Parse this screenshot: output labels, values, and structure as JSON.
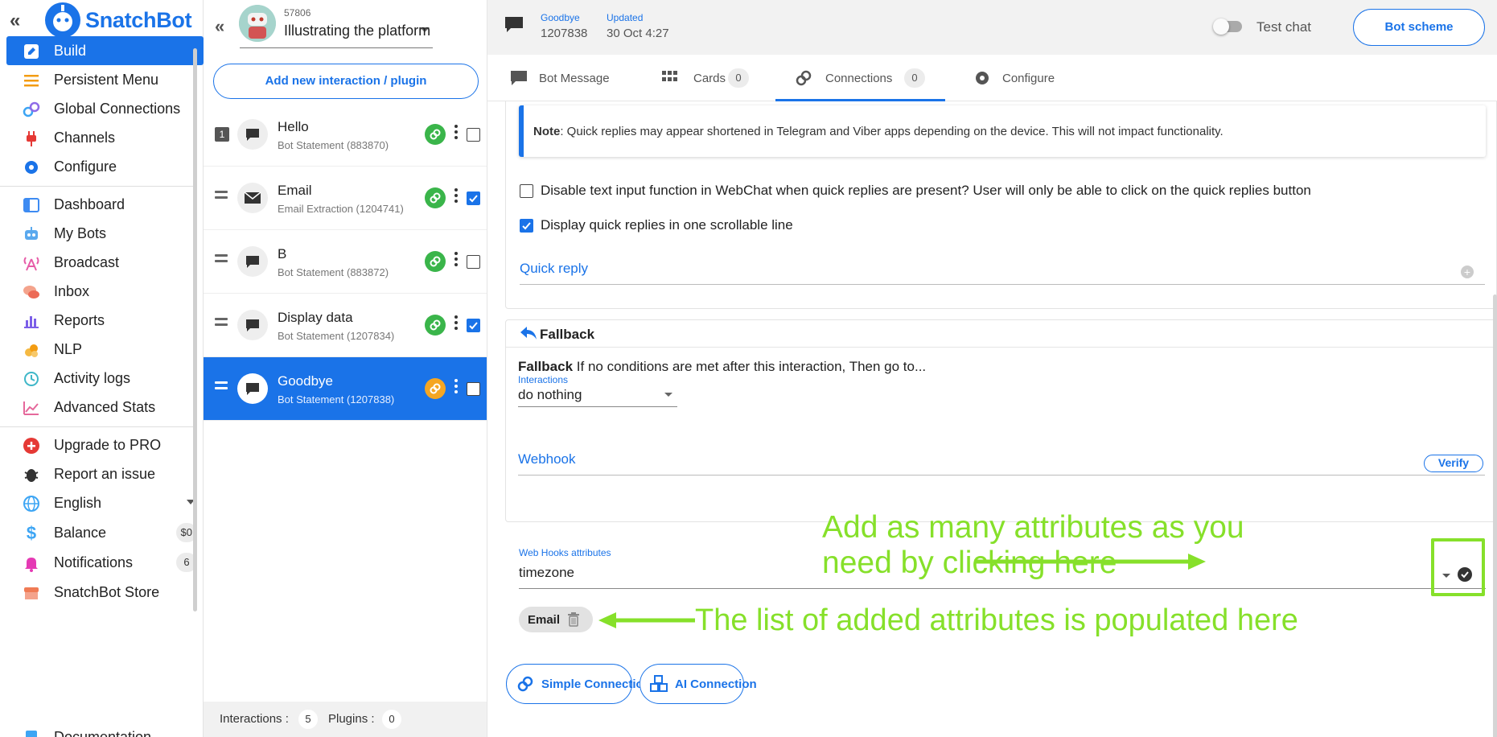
{
  "brand": {
    "name": "SnatchBot"
  },
  "sidebar": {
    "items": [
      {
        "label": "Build"
      },
      {
        "label": "Persistent Menu"
      },
      {
        "label": "Global Connections"
      },
      {
        "label": "Channels"
      },
      {
        "label": "Configure"
      },
      {
        "label": "Dashboard"
      },
      {
        "label": "My Bots"
      },
      {
        "label": "Broadcast"
      },
      {
        "label": "Inbox"
      },
      {
        "label": "Reports"
      },
      {
        "label": "NLP"
      },
      {
        "label": "Activity logs"
      },
      {
        "label": "Advanced Stats"
      },
      {
        "label": "Upgrade to PRO"
      },
      {
        "label": "Report an issue"
      },
      {
        "label": "English"
      },
      {
        "label": "Balance",
        "badge": "$0"
      },
      {
        "label": "Notifications",
        "badge": "6"
      },
      {
        "label": "SnatchBot Store"
      },
      {
        "label": "Documentation"
      }
    ]
  },
  "bot": {
    "id": "57806",
    "name": "Illustrating the platform"
  },
  "interactions": {
    "add_label": "Add new interaction / plugin",
    "rows": [
      {
        "index": "1",
        "title": "Hello",
        "subtitle": "Bot Statement (883870)",
        "checked": false
      },
      {
        "title": "Email",
        "subtitle": "Email Extraction (1204741)",
        "checked": true
      },
      {
        "title": "B",
        "subtitle": "Bot Statement (883872)",
        "checked": false
      },
      {
        "title": "Display data",
        "subtitle": "Bot Statement (1207834)",
        "checked": true
      },
      {
        "title": "Goodbye",
        "subtitle": "Bot Statement (1207838)",
        "checked": false
      }
    ],
    "footer": {
      "interactions_label": "Interactions :",
      "interactions_count": "5",
      "plugins_label": "Plugins :",
      "plugins_count": "0"
    }
  },
  "header": {
    "name": "Goodbye",
    "id": "1207838",
    "updated_label": "Updated",
    "updated_value": "30 Oct 4:27",
    "test_chat": "Test chat",
    "scheme_button": "Bot scheme"
  },
  "tabs": [
    {
      "label": "Bot Message"
    },
    {
      "label": "Cards",
      "count": "0"
    },
    {
      "label": "Connections",
      "count": "0"
    },
    {
      "label": "Configure"
    }
  ],
  "connections": {
    "note_bold": "Note",
    "note_text": ": Quick replies may appear shortened in Telegram and Viber apps depending on the device. This will not impact functionality.",
    "opt_disable": "Disable text input function in WebChat when quick replies are present?  User will only be able to click on the quick replies button",
    "opt_scroll": "Display quick replies in one scrollable line",
    "quick_reply": "Quick reply",
    "fallback_title": "Fallback",
    "fallback_bold": "Fallback",
    "fallback_text": " If no conditions are met after this interaction, Then go to...",
    "interactions_label": "Interactions",
    "interactions_value": "do nothing",
    "webhook": "Webhook",
    "verify": "Verify",
    "wh_attr_label": "Web Hooks attributes",
    "wh_attr_value": "timezone",
    "chip": "Email",
    "simple_btn": "Simple Connection",
    "ai_btn": "AI Connection"
  },
  "annotations": {
    "line1": "Add as many attributes as you",
    "line2": "need by clicking here",
    "line3": "The list of added attributes is populated here",
    "color": "#86e02a"
  },
  "colors": {
    "accent": "#1a73e8",
    "link_ok": "#3ab54a",
    "link_warn": "#f5a623"
  }
}
